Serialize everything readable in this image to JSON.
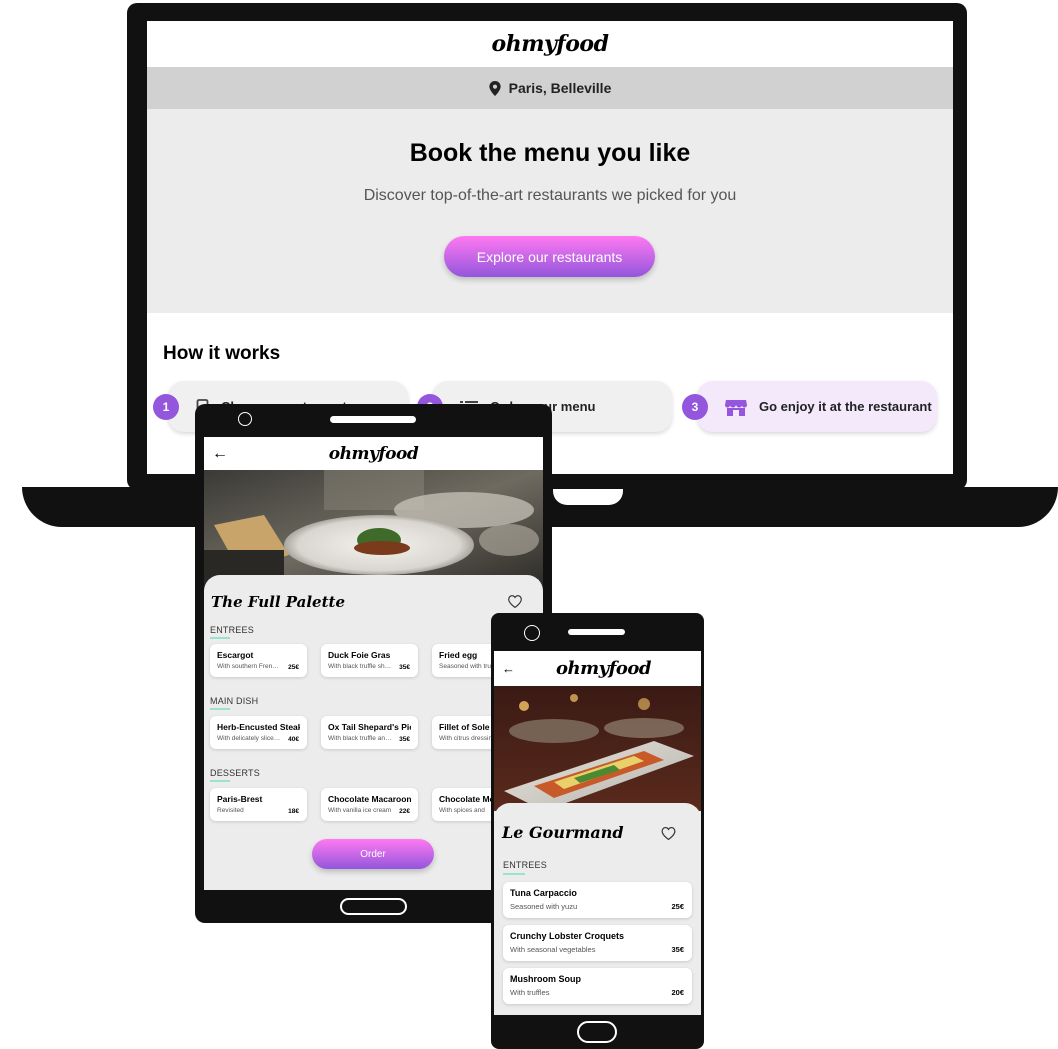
{
  "brand": {
    "logo_text": "ohmyfood",
    "accent_start": "#ff79f2",
    "accent_end": "#9356dc",
    "step_number_color": "#9356dc",
    "section_underline_color": "#99e2d0"
  },
  "laptop": {
    "location_icon": "map-pin-icon",
    "location": "Paris, Belleville",
    "hero_title": "Book the menu you like",
    "hero_subtitle": "Discover top-of-the-art restaurants we picked for you",
    "hero_button": "Explore our restaurants",
    "how_title": "How it works",
    "steps": [
      {
        "number": "1",
        "icon": "phone-icon",
        "label": "Choose a restaurant"
      },
      {
        "number": "2",
        "icon": "list-icon",
        "label": "Order your menu"
      },
      {
        "number": "3",
        "icon": "store-icon",
        "label": "Go enjoy it at the restaurant"
      }
    ]
  },
  "tablet": {
    "back_icon": "←",
    "restaurant_name": "The Full Palette",
    "sections": [
      {
        "title": "ENTREES",
        "dishes": [
          {
            "name": "Escargot",
            "desc": "With southern French flair",
            "price": "25€"
          },
          {
            "name": "Duck Foie Gras",
            "desc": "With black truffle shavings",
            "price": "35€"
          },
          {
            "name": "Fried egg",
            "desc": "Seasoned with truffle",
            "price": ""
          }
        ]
      },
      {
        "title": "MAIN DISH",
        "dishes": [
          {
            "name": "Herb-Encusted Steak",
            "desc": "With delicately sliced potatoes",
            "price": "40€"
          },
          {
            "name": "Ox Tail Shepard's Pie",
            "desc": "With black truffle and cheese",
            "price": "35€"
          },
          {
            "name": "Fillet of Sole",
            "desc": "With citrus dressing",
            "price": ""
          }
        ]
      },
      {
        "title": "DESSERTS",
        "dishes": [
          {
            "name": "Paris-Brest",
            "desc": "Revisited",
            "price": "18€"
          },
          {
            "name": "Chocolate Macaroons",
            "desc": "With vanilla ice cream",
            "price": "22€"
          },
          {
            "name": "Chocolate Mo",
            "desc": "With spices and",
            "price": ""
          }
        ]
      }
    ],
    "order_button": "Order"
  },
  "phone": {
    "back_icon": "←",
    "restaurant_name": "Le Gourmand",
    "section_title": "ENTREES",
    "dishes": [
      {
        "name": "Tuna Carpaccio",
        "desc": "Seasoned with yuzu",
        "price": "25€"
      },
      {
        "name": "Crunchy Lobster Croquets",
        "desc": "With seasonal vegetables",
        "price": "35€"
      },
      {
        "name": "Mushroom Soup",
        "desc": "With truffles",
        "price": "20€"
      }
    ]
  }
}
